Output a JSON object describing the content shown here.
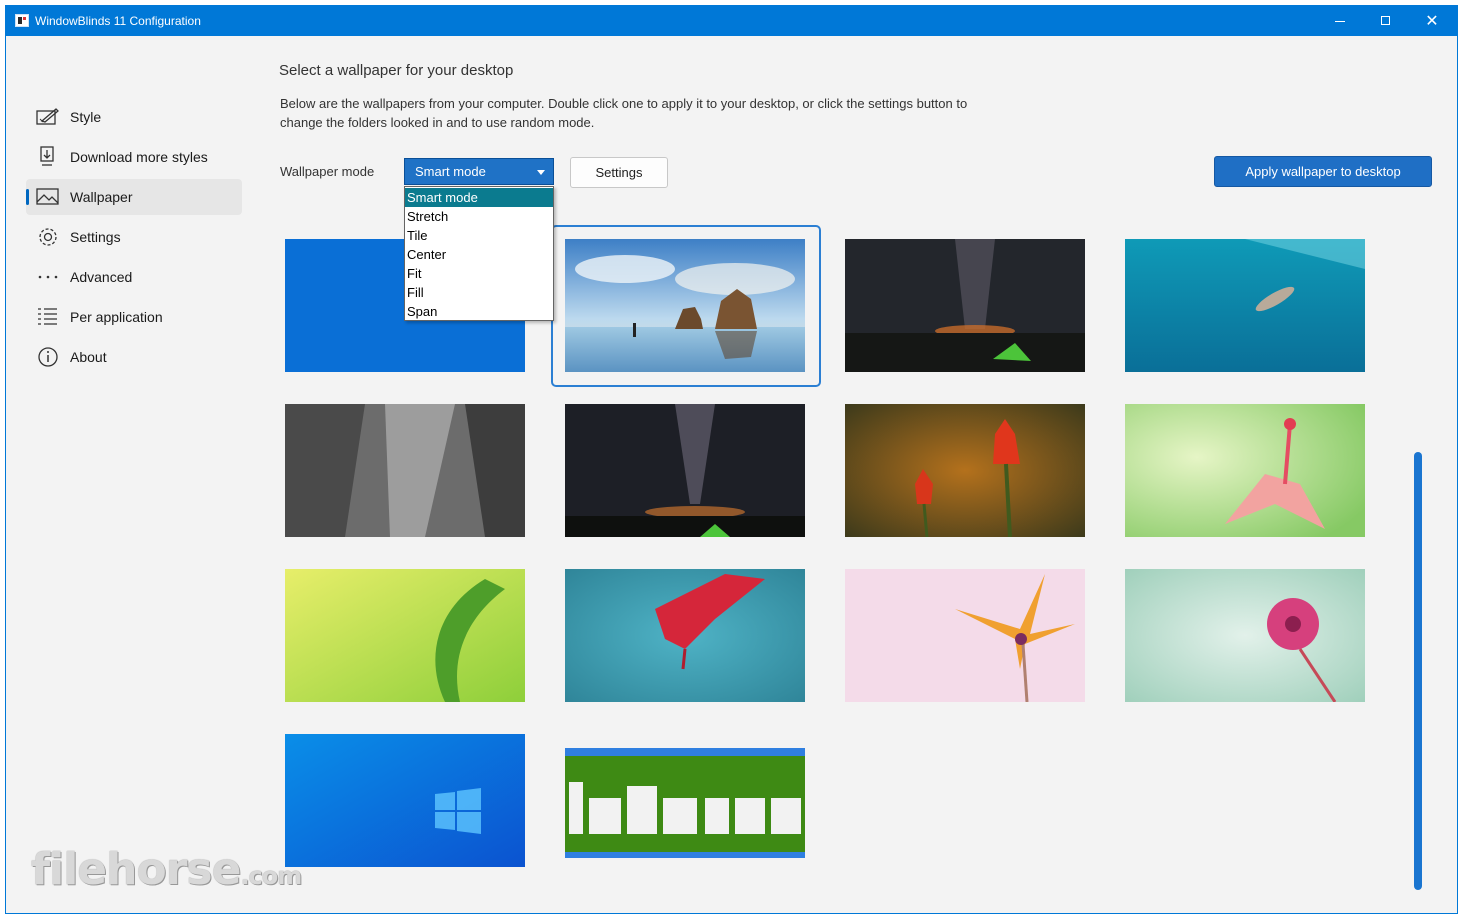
{
  "window": {
    "title": "WindowBlinds 11 Configuration"
  },
  "sidebar": {
    "items": [
      {
        "label": "Style",
        "icon": "style-icon"
      },
      {
        "label": "Download more styles",
        "icon": "download-icon"
      },
      {
        "label": "Wallpaper",
        "icon": "wallpaper-icon",
        "active": true
      },
      {
        "label": "Settings",
        "icon": "gear-icon"
      },
      {
        "label": "Advanced",
        "icon": "more-icon"
      },
      {
        "label": "Per application",
        "icon": "list-icon"
      },
      {
        "label": "About",
        "icon": "info-icon"
      }
    ]
  },
  "main": {
    "heading": "Select a wallpaper for your desktop",
    "description": "Below are the wallpapers from your computer.  Double click one to apply it to your desktop, or click the settings button to change the folders looked in and to use random mode.",
    "mode_label": "Wallpaper mode",
    "mode_value": "Smart mode",
    "mode_options": [
      "Smart mode",
      "Stretch",
      "Tile",
      "Center",
      "Fit",
      "Fill",
      "Span"
    ],
    "settings_button": "Settings",
    "apply_button": "Apply wallpaper to desktop"
  },
  "wallpapers": [
    {
      "name": "solid-blue"
    },
    {
      "name": "beach-rocks",
      "selected": true
    },
    {
      "name": "night-tent"
    },
    {
      "name": "underwater-swimmer"
    },
    {
      "name": "rock-face"
    },
    {
      "name": "milky-way"
    },
    {
      "name": "red-tulips"
    },
    {
      "name": "pink-flower-green"
    },
    {
      "name": "green-leaf"
    },
    {
      "name": "red-flower-teal"
    },
    {
      "name": "orange-flower-pink"
    },
    {
      "name": "pink-flower-mint"
    },
    {
      "name": "windows-logo"
    },
    {
      "name": "filehorse-image"
    }
  ],
  "watermark": {
    "text": "filehorse",
    "suffix": ".com"
  },
  "colors": {
    "accent": "#0078d7",
    "selected_option": "#0b7b8f",
    "apply_button": "#1f6fc5"
  }
}
